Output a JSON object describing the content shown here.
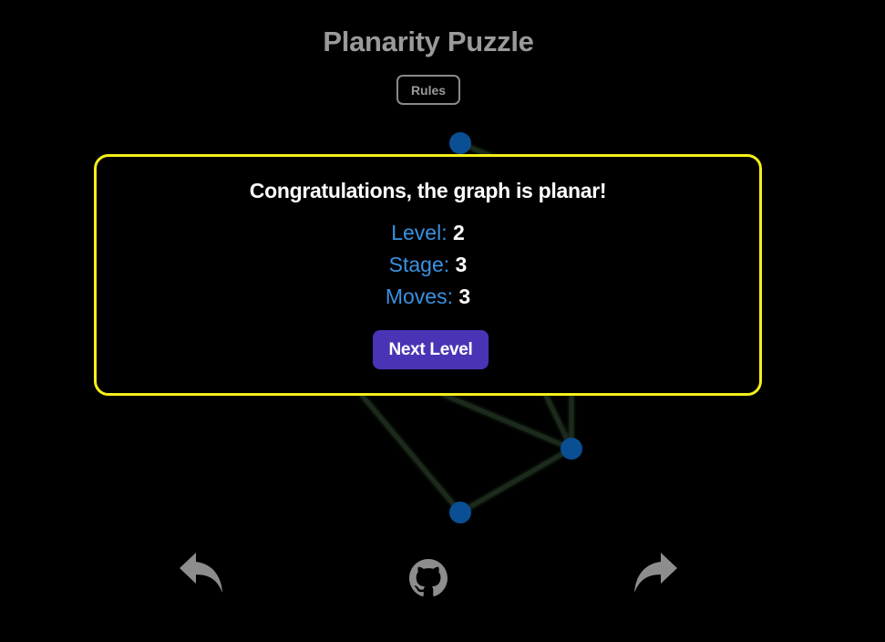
{
  "header": {
    "title": "Planarity Puzzle",
    "rules_label": "Rules"
  },
  "modal": {
    "message": "Congratulations, the graph is planar!",
    "level_label": "Level:",
    "level_value": "2",
    "stage_label": "Stage:",
    "stage_value": "3",
    "moves_label": "Moves:",
    "moves_value": "3",
    "next_label": "Next Level"
  },
  "toolbar": {
    "undo_icon": "undo-arrow-icon",
    "github_icon": "github-icon",
    "redo_icon": "redo-arrow-icon"
  },
  "colors": {
    "background": "#000000",
    "modal_border": "#f5ef1a",
    "stat_label": "#3a91e0",
    "next_button": "#4a34b5",
    "node": "#0a4f94",
    "edge": "#1b2a1b",
    "icons": "#8d8d8d"
  }
}
